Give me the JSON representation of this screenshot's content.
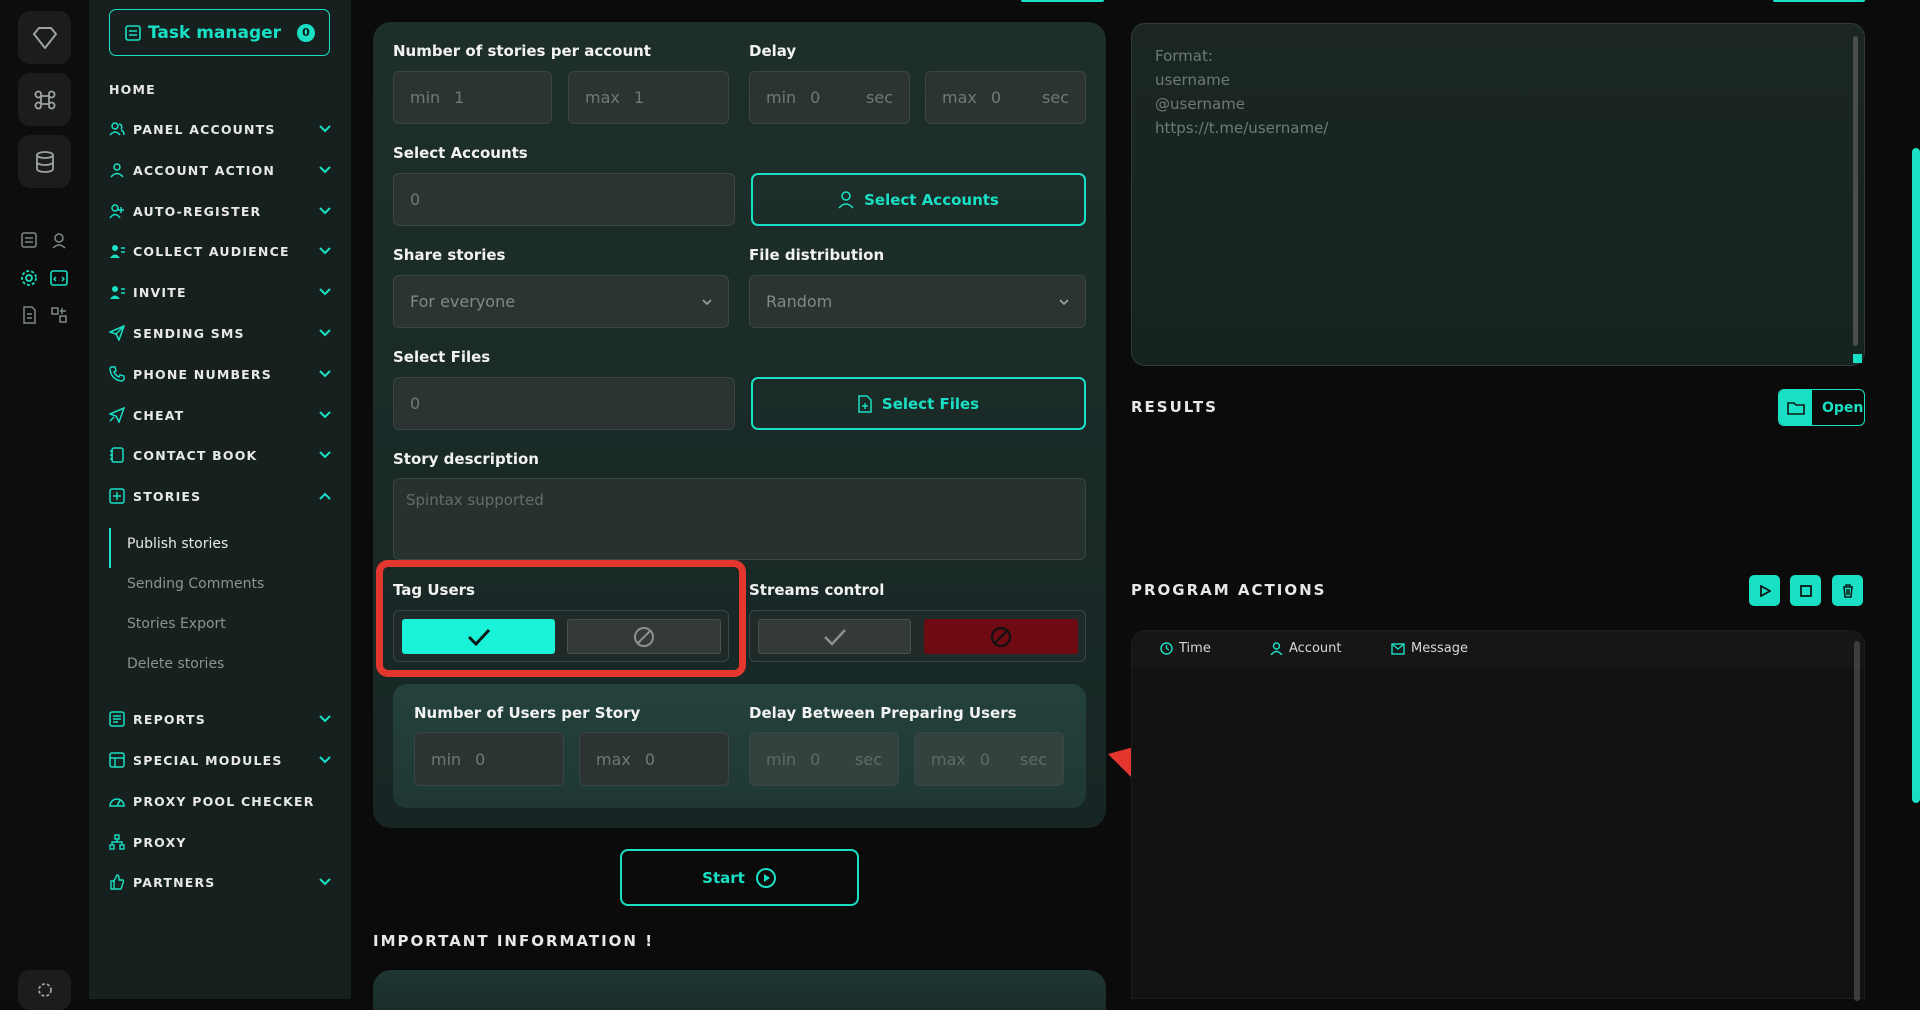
{
  "sidebar": {
    "task_manager": "Task manager",
    "task_badge": "0",
    "items": [
      {
        "label": "HOME"
      },
      {
        "label": "PANEL ACCOUNTS"
      },
      {
        "label": "ACCOUNT ACTION"
      },
      {
        "label": "AUTO-REGISTER"
      },
      {
        "label": "COLLECT AUDIENCE"
      },
      {
        "label": "INVITE"
      },
      {
        "label": "SENDING SMS"
      },
      {
        "label": "PHONE NUMBERS"
      },
      {
        "label": "CHEAT"
      },
      {
        "label": "CONTACT BOOK"
      },
      {
        "label": "STORIES"
      },
      {
        "label": "REPORTS"
      },
      {
        "label": "SPECIAL MODULES"
      },
      {
        "label": "PROXY POOL CHECKER"
      },
      {
        "label": "PROXY"
      },
      {
        "label": "PARTNERS"
      }
    ],
    "stories_sub": [
      "Publish stories",
      "Sending Comments",
      "Stories Export",
      "Delete stories"
    ]
  },
  "form": {
    "stories_per_account_label": "Number of stories per account",
    "delay_label": "Delay",
    "min": "min",
    "max": "max",
    "sec": "sec",
    "stories_min": "1",
    "stories_max": "1",
    "delay_min": "0",
    "delay_max": "0",
    "select_accounts_label": "Select Accounts",
    "select_accounts_value": "0",
    "select_accounts_button": "Select Accounts",
    "share_stories_label": "Share stories",
    "share_stories_value": "For everyone",
    "file_distribution_label": "File distribution",
    "file_distribution_value": "Random",
    "select_files_label": "Select Files",
    "select_files_value": "0",
    "select_files_button": "Select Files",
    "story_description_label": "Story description",
    "story_description_placeholder": "Spintax supported",
    "tag_users_label": "Tag Users",
    "streams_control_label": "Streams control",
    "users_per_story_label": "Number of Users per Story",
    "users_min": "0",
    "users_max": "0",
    "delay_preparing_label": "Delay Between Preparing Users",
    "prep_min": "0",
    "prep_max": "0",
    "start_button": "Start",
    "important_info": "IMPORTANT INFORMATION !"
  },
  "right": {
    "format_lines": [
      "Format:",
      "username",
      "@username",
      "https://t.me/username/"
    ],
    "results_title": "RESULTS",
    "open_button": "Open",
    "program_actions_title": "PROGRAM ACTIONS",
    "columns": [
      "Time",
      "Account",
      "Message"
    ]
  },
  "colors": {
    "accent": "#19e0c4",
    "danger": "#6e0a12",
    "highlight": "#e2362f"
  }
}
